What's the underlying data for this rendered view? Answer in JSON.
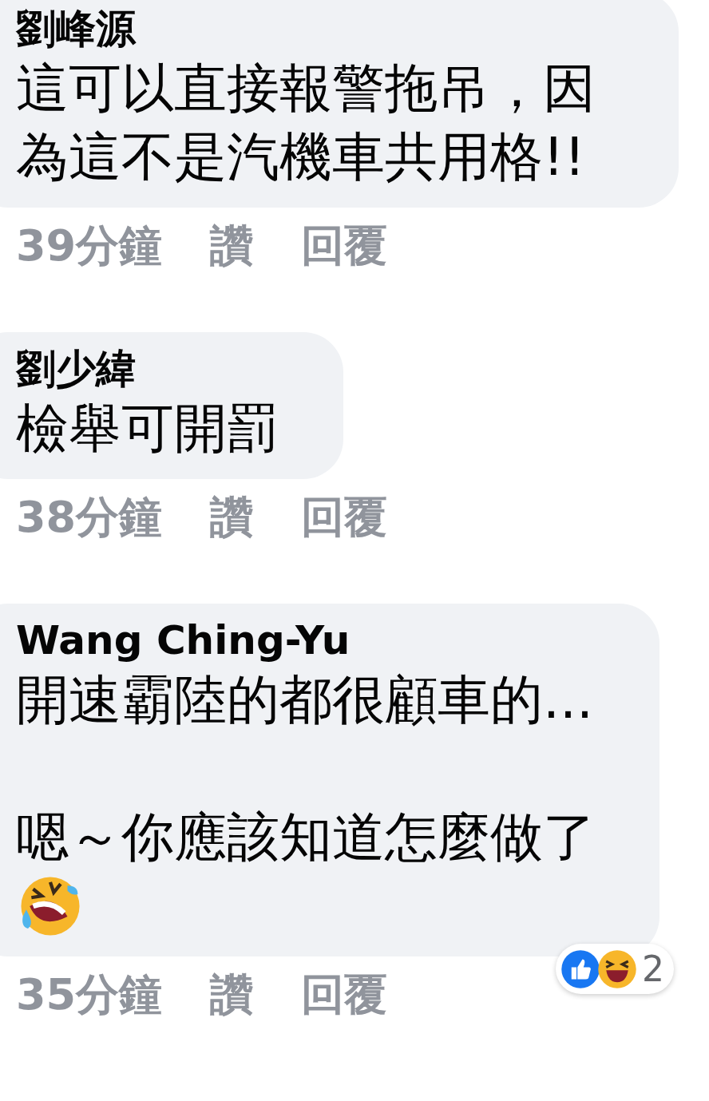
{
  "comments": [
    {
      "author": "劉峰源",
      "paragraphs": [
        "這可以直接報警拖吊，因為這不是汽機車共用格!!"
      ],
      "emoji": false,
      "time": "39分鐘",
      "like": "讚",
      "reply": "回覆"
    },
    {
      "author": "劉少緯",
      "paragraphs": [
        "檢舉可開罰"
      ],
      "emoji": false,
      "time": "38分鐘",
      "like": "讚",
      "reply": "回覆"
    },
    {
      "author": "Wang Ching-Yu",
      "paragraphs": [
        "開速霸陸的都很顧車的...",
        "嗯～你應該知道怎麼做了"
      ],
      "emoji": true,
      "time": "35分鐘",
      "like": "讚",
      "reply": "回覆",
      "reactions": {
        "count": "2"
      }
    }
  ]
}
